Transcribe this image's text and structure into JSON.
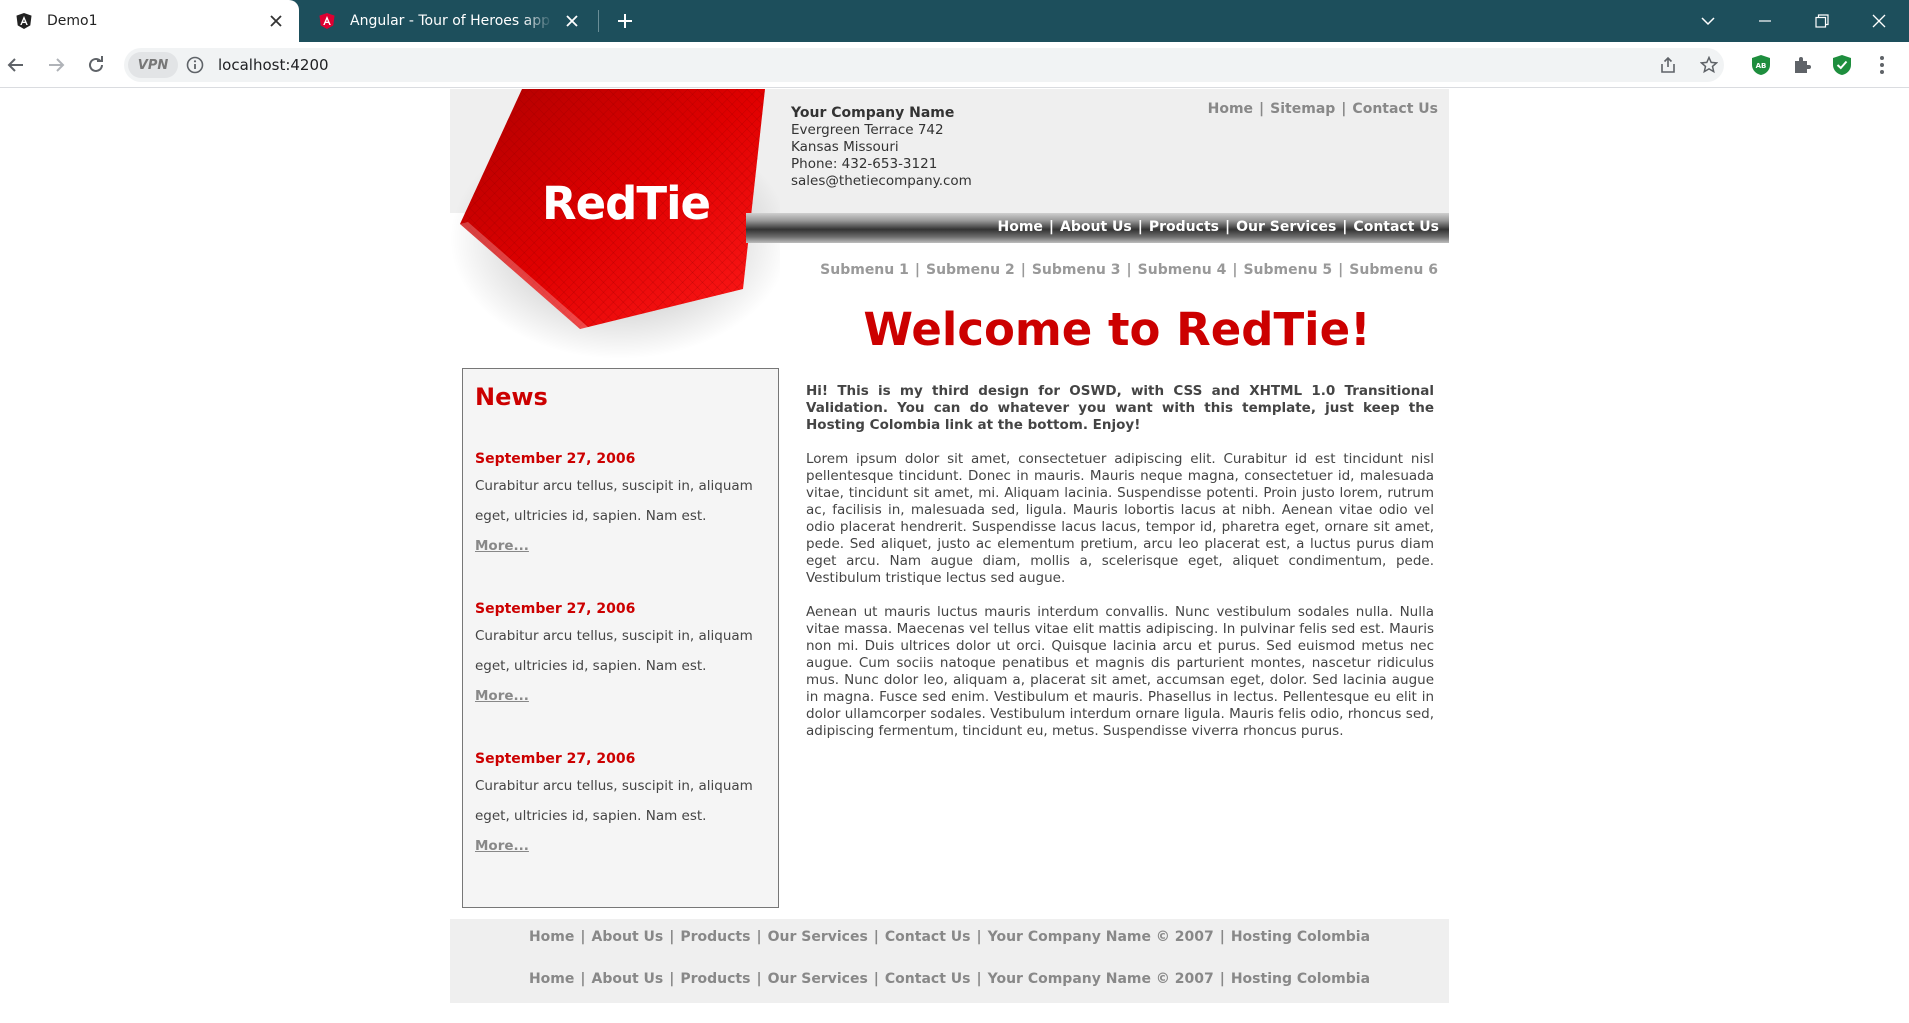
{
  "browser": {
    "tabs": [
      {
        "title": "Demo1",
        "active": true
      },
      {
        "title": "Angular - Tour of Heroes app and tutorial",
        "active": false
      }
    ],
    "address": {
      "vpn_label": "VPN",
      "url": "localhost:4200"
    }
  },
  "site": {
    "logo_text": "RedTie",
    "company": {
      "name": "Your Company Name",
      "street": "Evergreen Terrace 742",
      "city": "Kansas Missouri",
      "phone": "Phone: 432-653-3121",
      "email": "sales@thetiecompany.com"
    },
    "topnav": [
      "Home",
      "Sitemap",
      "Contact Us"
    ],
    "mainnav": [
      "Home",
      "About Us",
      "Products",
      "Our Services",
      "Contact Us"
    ],
    "subnav": [
      "Submenu 1",
      "Submenu 2",
      "Submenu 3",
      "Submenu 4",
      "Submenu 5",
      "Submenu 6"
    ],
    "welcome": "Welcome to RedTie!",
    "news": {
      "title": "News",
      "items": [
        {
          "date": "September 27, 2006",
          "text": "Curabitur arcu tellus, suscipit in, aliquam eget, ultricies id, sapien. Nam est.",
          "more": "More..."
        },
        {
          "date": "September 27, 2006",
          "text": "Curabitur arcu tellus, suscipit in, aliquam eget, ultricies id, sapien. Nam est.",
          "more": "More..."
        },
        {
          "date": "September 27, 2006",
          "text": "Curabitur arcu tellus, suscipit in, aliquam eget, ultricies id, sapien. Nam est.",
          "more": "More..."
        }
      ]
    },
    "content": {
      "intro": "Hi! This is my third design for OSWD, with CSS and XHTML 1.0 Transitional Validation. You can do whatever you want with this template, just keep the Hosting Colombia link at the bottom. Enjoy!",
      "p1": "Lorem ipsum dolor sit amet, consectetuer adipiscing elit. Curabitur id est tincidunt nisl pellentesque tincidunt. Donec in mauris. Mauris neque magna, consectetuer id, malesuada vitae, tincidunt sit amet, mi. Aliquam lacinia. Suspendisse potenti. Proin justo lorem, rutrum ac, facilisis in, malesuada sed, ligula. Mauris lobortis lacus at nibh. Aenean vitae odio vel odio placerat hendrerit. Suspendisse lacus lacus, tempor id, pharetra eget, ornare sit amet, pede. Sed aliquet, justo ac elementum pretium, arcu leo placerat est, a luctus purus diam eget arcu. Nam augue diam, mollis a, scelerisque eget, aliquet condimentum, pede. Vestibulum tristique lectus sed augue.",
      "p2": "Aenean ut mauris luctus mauris interdum convallis. Nunc vestibulum sodales nulla. Nulla vitae massa. Maecenas vel tellus vitae elit mattis adipiscing. In pulvinar felis sed est. Mauris non mi. Duis ultrices dolor ut orci. Quisque lacinia arcu et purus. Sed euismod metus nec augue. Cum sociis natoque penatibus et magnis dis parturient montes, nascetur ridiculus mus. Nunc dolor leo, aliquam a, placerat sit amet, accumsan eget, dolor. Sed lacinia augue in magna. Fusce sed enim. Vestibulum et mauris. Phasellus in lectus. Pellentesque eu elit in dolor ullamcorper sodales. Vestibulum interdum ornare ligula. Mauris felis odio, rhoncus sed, adipiscing fermentum, tincidunt eu, metus. Suspendisse viverra rhoncus purus."
    },
    "footer": {
      "links": [
        "Home",
        "About Us",
        "Products",
        "Our Services",
        "Contact Us",
        "Your Company Name © 2007",
        "Hosting Colombia"
      ]
    }
  },
  "colors": {
    "accent": "#cc0000",
    "tabbar": "#1d4f5c"
  }
}
